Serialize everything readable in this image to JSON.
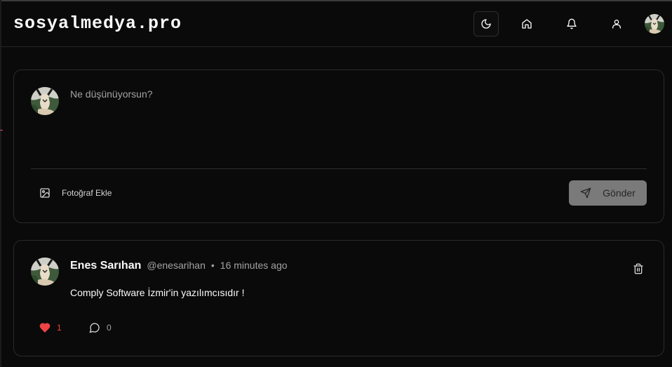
{
  "colors": {
    "background": "#0a0a0a",
    "border": "#2a2a2a",
    "text": "#fafafa",
    "muted": "#a3a3a3",
    "like": "#ef4444",
    "send_button": "#7a7a7a"
  },
  "header": {
    "brand": "sosyalmedya.pro",
    "icons": [
      "moon-icon",
      "home-icon",
      "bell-icon",
      "user-icon"
    ]
  },
  "composer": {
    "placeholder": "Ne düşünüyorsun?",
    "value": "",
    "add_photo_label": "Fotoğraf Ekle",
    "send_label": "Gönder"
  },
  "posts": [
    {
      "author_name": "Enes Sarıhan",
      "author_handle": "@enesarihan",
      "separator": "•",
      "time": "16 minutes ago",
      "text": "Comply Software İzmir'in yazılımcısıdır !",
      "likes": "1",
      "comments": "0",
      "liked": true
    }
  ]
}
